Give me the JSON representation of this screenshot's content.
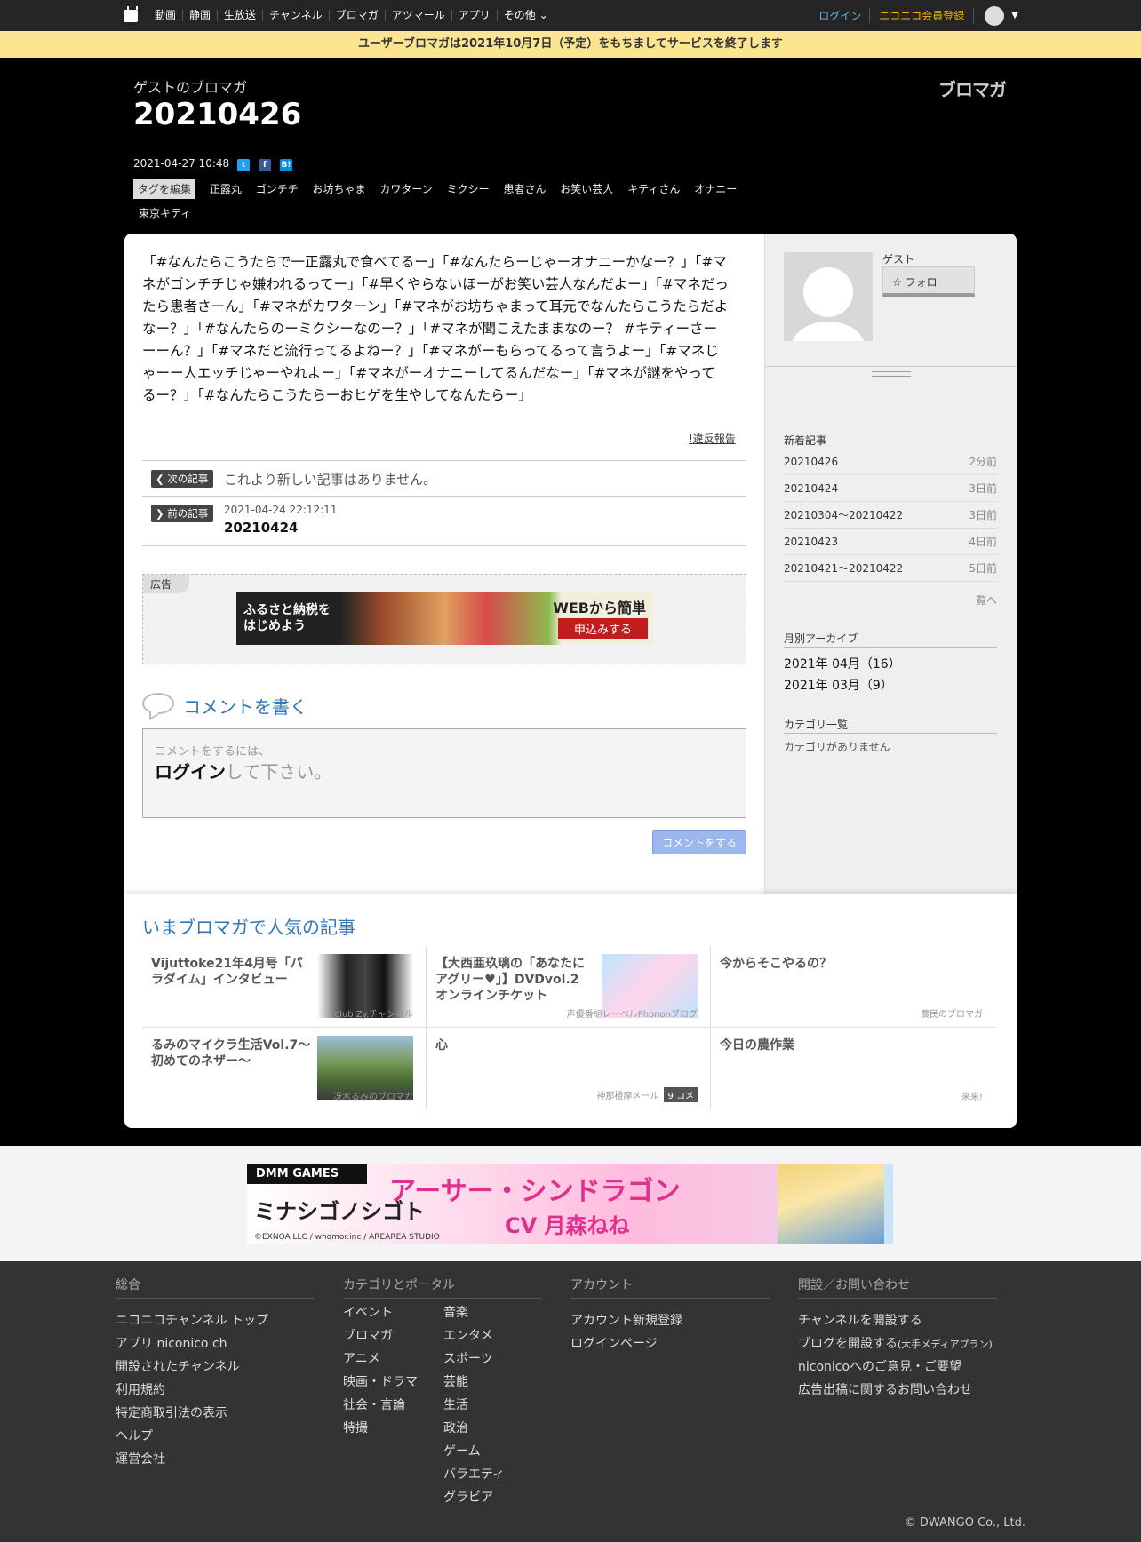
{
  "topbar": {
    "nav": [
      "動画",
      "静画",
      "生放送",
      "チャンネル",
      "ブロマガ",
      "アツマール",
      "アプリ",
      "その他"
    ],
    "login": "ログイン",
    "register": "ニコニコ会員登録"
  },
  "notice": "ユーザーブロマガは2021年10月7日（予定）をもちましてサービスを終了します",
  "header": {
    "blog_name": "ゲストのブロマガ",
    "title": "20210426",
    "brand": "ブロマガ",
    "date": "2021-04-27 10:48",
    "tag_edit": "タグを編集",
    "tags": [
      "正露丸",
      "ゴンチチ",
      "お坊ちゃま",
      "カワターン",
      "ミクシー",
      "患者さん",
      "お笑い芸人",
      "キティさん",
      "オナニー",
      "東京キティ"
    ]
  },
  "article": {
    "body": "「#なんたらこうたらで一正露丸で食べてるー」「#なんたらーじゃーオナニーかなー？」「#マネがゴンチチじゃ嫌われるってー」「#早くやらないほーがお笑い芸人なんだよー」「#マネだったら患者さーん」「#マネがカワターン」「#マネがお坊ちゃまって耳元でなんたらこうたらだよなー？」「#なんたらのーミクシーなのー？」「#マネが聞こえたままなのー？ #キティーさーーーん？」「#マネだと流行ってるよねー？」「#マネがーもらってるって言うよー」「#マネじゃーー人エッチじゃーやれよー」「#マネがーオナニーしてるんだなー」「#マネが謎をやってるー？」「#なんたらこうたらーおヒゲを生やしてなんたらー」",
    "report": "!違反報告"
  },
  "nav": {
    "next_label": "次の記事",
    "next_text": "これより新しい記事はありません。",
    "prev_label": "前の記事",
    "prev_date": "2021-04-24 22:12:11",
    "prev_title": "20210424"
  },
  "ad": {
    "label": "広告",
    "banner_left": "ふるさと納税を\nはじめよう",
    "banner_right1": "WEBから簡単",
    "banner_right2": "申込みする"
  },
  "comment": {
    "title": "コメントを書く",
    "small": "コメントをするには、",
    "login": "ログイン",
    "rest": "して下さい。",
    "button": "コメントをする"
  },
  "sidebar": {
    "guest": "ゲスト",
    "follow": "☆ フォロー",
    "recent_title": "新着記事",
    "recent": [
      {
        "title": "20210426",
        "ago": "2分前"
      },
      {
        "title": "20210424",
        "ago": "3日前"
      },
      {
        "title": "20210304～20210422",
        "ago": "3日前"
      },
      {
        "title": "20210423",
        "ago": "4日前"
      },
      {
        "title": "20210421～20210422",
        "ago": "5日前"
      }
    ],
    "more": "一覧へ",
    "archive_title": "月別アーカイブ",
    "archives": [
      "2021年 04月（16）",
      "2021年 03月（9）"
    ],
    "category_title": "カテゴリ一覧",
    "no_category": "カテゴリがありません"
  },
  "popular": {
    "title": "いまブロマガで人気の記事",
    "items": [
      {
        "title": "Vijuttoke21年4月号「パラダイム」インタビュー",
        "source": "club Zy.チャンネル"
      },
      {
        "title": "【大西亜玖璃の「あなたにアグリー♥」】DVDvol.2 オンラインチケット",
        "source": "声優番組レーベルPhononブログ"
      },
      {
        "title": "今からそこやるの？",
        "source": "農民のブロマガ"
      },
      {
        "title": "るみのマイクラ生活Vol.7～初めてのネザー～",
        "source": "冴木るみのブロマガ"
      },
      {
        "title": "心",
        "source": "神那橙摩メール",
        "count": "9 コメ"
      },
      {
        "title": "今日の農作業",
        "source": "来来!"
      }
    ]
  },
  "footer_ad": {
    "brand": "DMM GAMES",
    "game": "ミナシゴノシゴト",
    "name": "アーサー・シンドラゴン",
    "cv": "CV 月森ねね",
    "copyright": "©EXNOA LLC / whomor.inc / AREAREA STUDIO"
  },
  "footer": {
    "col1_title": "総合",
    "col1": [
      "ニコニコチャンネル トップ",
      "アプリ niconico ch",
      "開設されたチャンネル",
      "利用規約",
      "特定商取引法の表示",
      "ヘルプ",
      "運営会社"
    ],
    "col2_title": "カテゴリとポータル",
    "col2a": [
      "イベント",
      "ブロマガ",
      "アニメ",
      "映画・ドラマ",
      "社会・言論",
      "特撮"
    ],
    "col2b": [
      "音楽",
      "エンタメ",
      "スポーツ",
      "芸能",
      "生活",
      "政治",
      "ゲーム",
      "バラエティ",
      "グラビア"
    ],
    "col3_title": "アカウント",
    "col3": [
      "アカウント新規登録",
      "ログインページ"
    ],
    "col4_title": "開設／お問い合わせ",
    "col4": [
      "チャンネルを開設する",
      "ブログを開設する",
      "niconicoへのご意見・ご要望",
      "広告出稿に関するお問い合わせ"
    ],
    "col4_small": "(大手メディアプラン)",
    "copyright": "© DWANGO Co., Ltd."
  }
}
